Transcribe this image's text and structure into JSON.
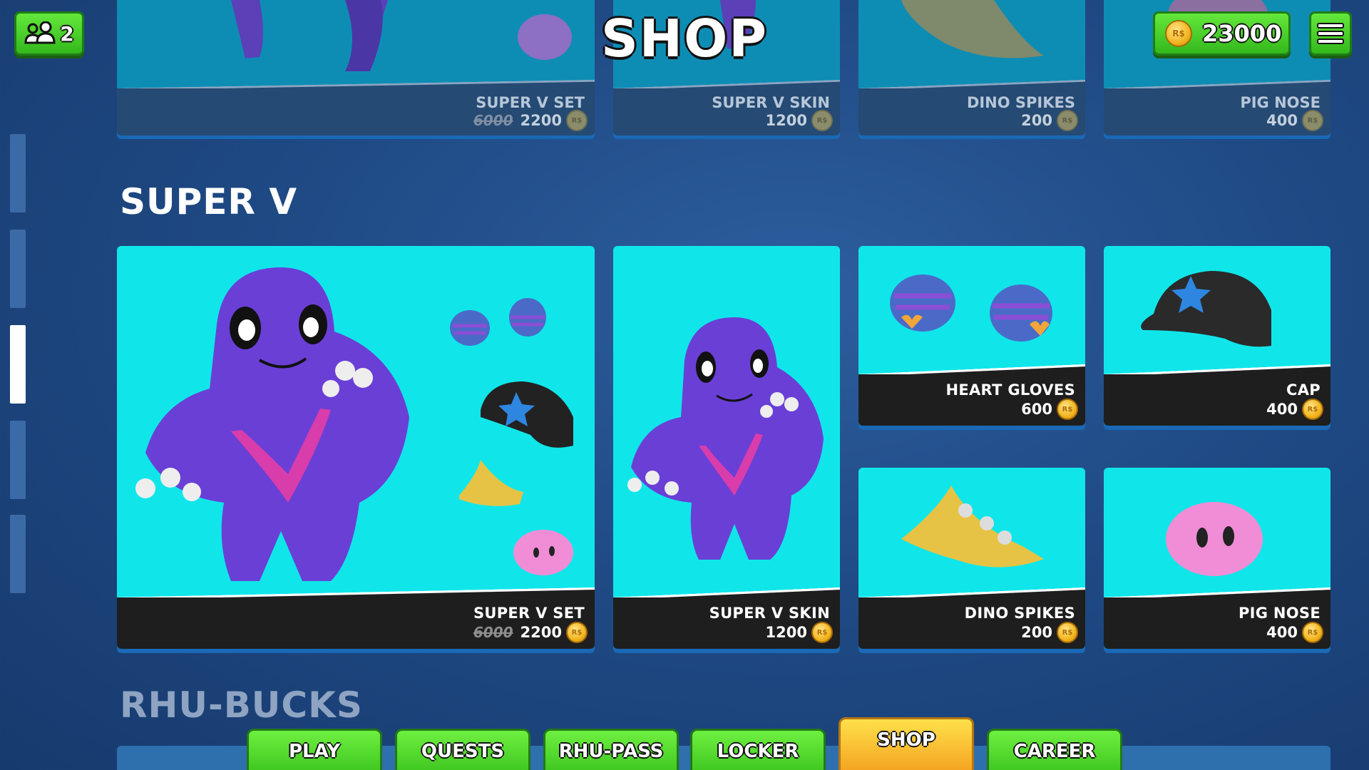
{
  "header": {
    "title": "SHOP",
    "party_count": "2",
    "currency_amount": "23000",
    "coin_symbol": "R$"
  },
  "top_row": [
    {
      "name": "SUPER V SET",
      "old_price": "6000",
      "price": "2200"
    },
    {
      "name": "SUPER V SKIN",
      "price": "1200"
    },
    {
      "name": "DINO SPIKES",
      "price": "200"
    },
    {
      "name": "PIG NOSE",
      "price": "400"
    }
  ],
  "section": {
    "title": "SUPER V",
    "items": [
      {
        "name": "SUPER V SET",
        "old_price": "6000",
        "price": "2200"
      },
      {
        "name": "SUPER V SKIN",
        "price": "1200"
      },
      {
        "name": "HEART GLOVES",
        "price": "600"
      },
      {
        "name": "CAP",
        "price": "400"
      },
      {
        "name": "DINO SPIKES",
        "price": "200"
      },
      {
        "name": "PIG NOSE",
        "price": "400"
      }
    ]
  },
  "next_section": {
    "title": "RHU-BUCKS"
  },
  "nav_tabs": [
    "PLAY",
    "QUESTS",
    "RHU-PASS",
    "LOCKER",
    "SHOP",
    "CAREER"
  ],
  "active_tab": "SHOP",
  "colors": {
    "card_bg": "#10e6ea",
    "button_green": "#3ac21d",
    "active_tab": "#f4a320",
    "background": "#1f4a85"
  }
}
